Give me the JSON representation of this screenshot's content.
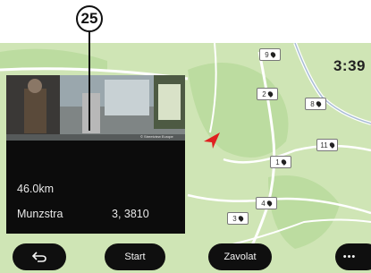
{
  "callout": {
    "number": "25"
  },
  "status": {
    "clock": "3:39"
  },
  "panel": {
    "distance": "46.0km",
    "street": "Munzstra",
    "code": "3, 3810",
    "photo_credit": "© Streetview Europe"
  },
  "map": {
    "camera_markers": [
      "9",
      "2",
      "8",
      "11",
      "1",
      "4",
      "3"
    ]
  },
  "buttons": {
    "back_icon": "back-arrow-icon",
    "start_label": "Start",
    "call_label": "Zavolat",
    "more_label": "•••"
  },
  "colors": {
    "map_land": "#cfe5b5",
    "panel": "#0c0c0c",
    "nav_arrow": "#e02020"
  }
}
